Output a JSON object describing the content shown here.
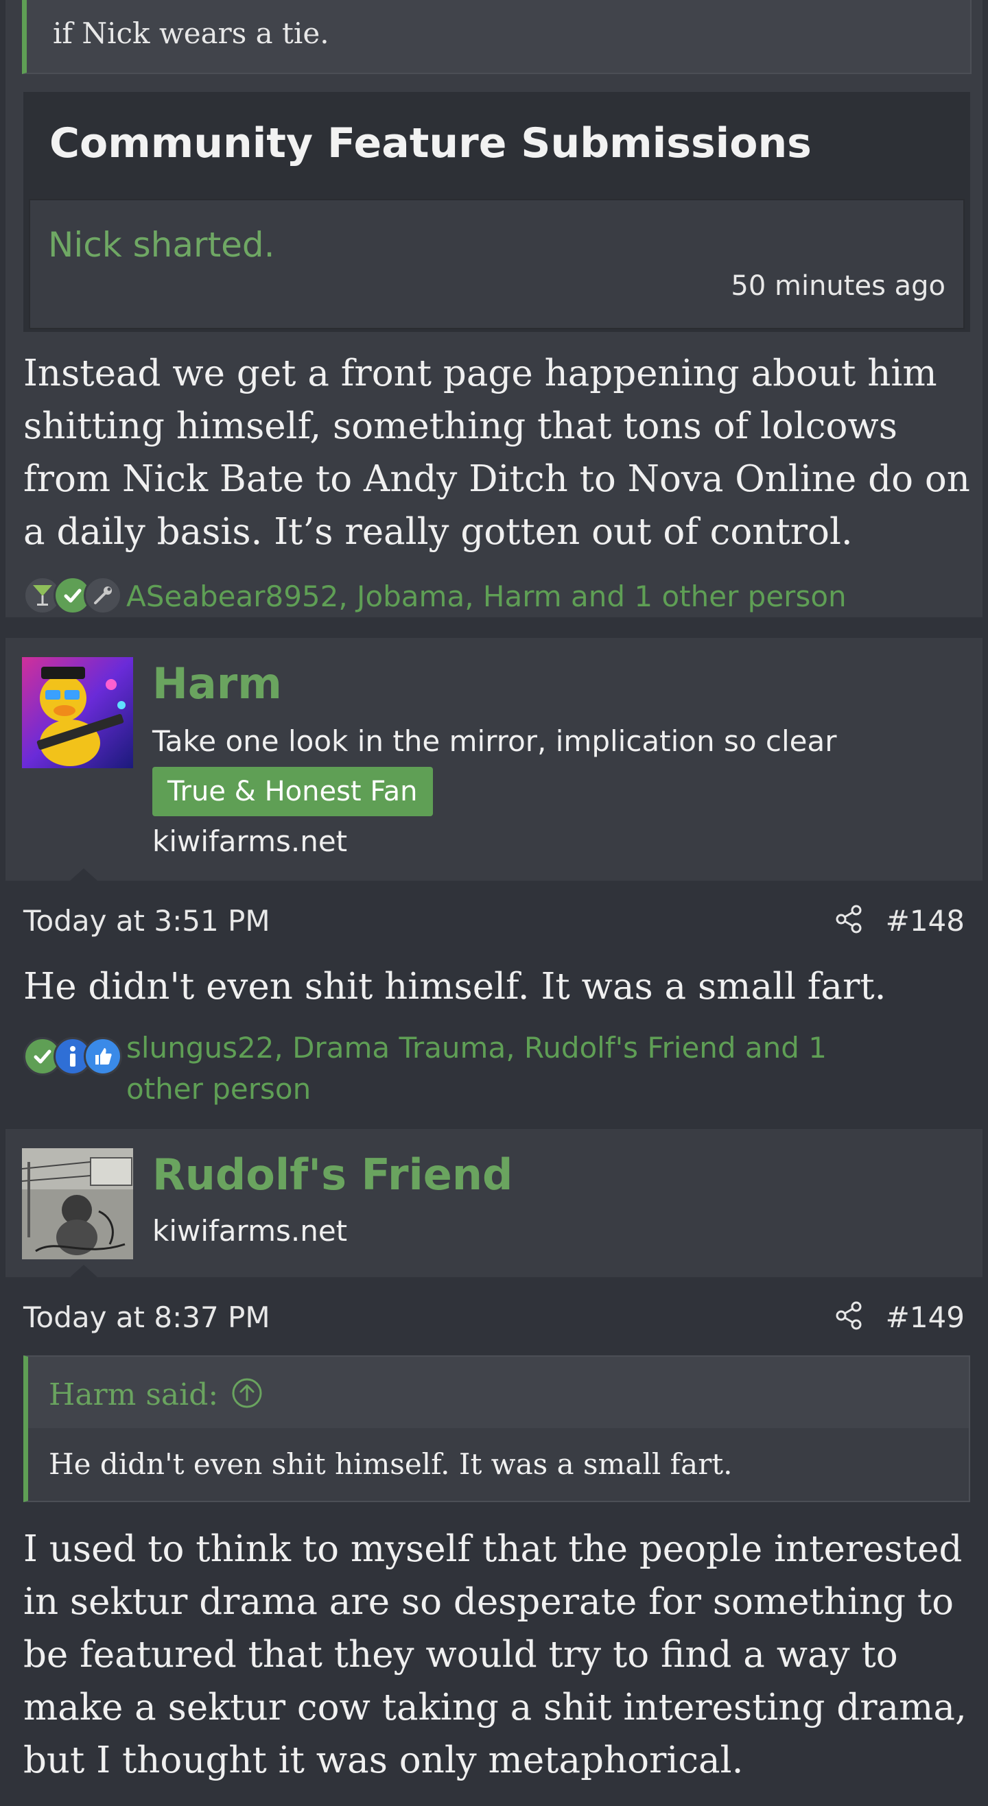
{
  "post1": {
    "quote_text": "if Nick wears a tie.",
    "feature": {
      "title": "Community Feature Submissions",
      "headline": "Nick sharted.",
      "time": "50 minutes ago"
    },
    "body": "Instead we get a front page happening about him shitting himself, something that tons of lolcows from Nick Bate to Andy Ditch to Nova Online do on a daily basis. It’s really gotten out of control.",
    "reactions": {
      "icons": [
        "cocktail-icon",
        "check-icon",
        "wrench-icon"
      ],
      "text": "ASeabear8952, Jobama, Harm and 1 other person"
    }
  },
  "post2": {
    "user": {
      "name": "Harm",
      "title": "Take one look in the mirror, implication so clear",
      "badge": "True & Honest Fan",
      "site": "kiwifarms.net"
    },
    "date": "Today at 3:51 PM",
    "number": "#148",
    "body": "He didn't even shit himself. It was a small fart.",
    "reactions": {
      "icons": [
        "check-icon",
        "info-icon",
        "thumbs-up-icon"
      ],
      "text": "slungus22, Drama Trauma, Rudolf's Friend and 1 other person"
    }
  },
  "post3": {
    "user": {
      "name": "Rudolf's Friend",
      "site": "kiwifarms.net"
    },
    "date": "Today at 8:37 PM",
    "number": "#149",
    "quote": {
      "author": "Harm said:",
      "text": "He didn't even shit himself. It was a small fart."
    },
    "body": "I used to think to myself that the people interested in sektur drama are so desperate for something to be featured that they would try to find a way to make a sektur cow taking a shit interesting drama, but I thought it was only metaphorical."
  },
  "colors": {
    "accent": "#5f9f55",
    "background": "#30333a",
    "panel": "#3a3d44"
  }
}
